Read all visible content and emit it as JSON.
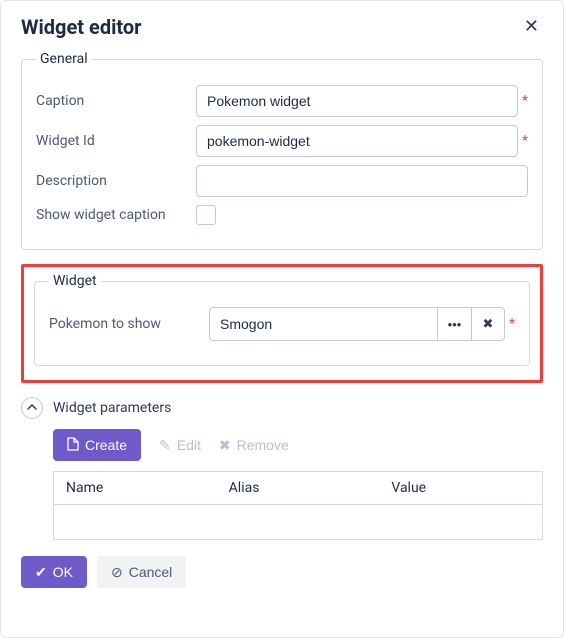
{
  "title": "Widget editor",
  "sections": {
    "general": {
      "legend": "General",
      "caption_label": "Caption",
      "caption_value": "Pokemon widget",
      "widget_id_label": "Widget Id",
      "widget_id_value": "pokemon-widget",
      "description_label": "Description",
      "description_value": "",
      "show_caption_label": "Show widget caption",
      "show_caption_checked": false
    },
    "widget": {
      "legend": "Widget",
      "pokemon_label": "Pokemon to show",
      "pokemon_value": "Smogon"
    },
    "params": {
      "title": "Widget parameters",
      "create_label": "Create",
      "edit_label": "Edit",
      "remove_label": "Remove",
      "columns": {
        "name": "Name",
        "alias": "Alias",
        "value": "Value"
      },
      "rows": []
    }
  },
  "footer": {
    "ok": "OK",
    "cancel": "Cancel"
  },
  "required_mark": "*"
}
